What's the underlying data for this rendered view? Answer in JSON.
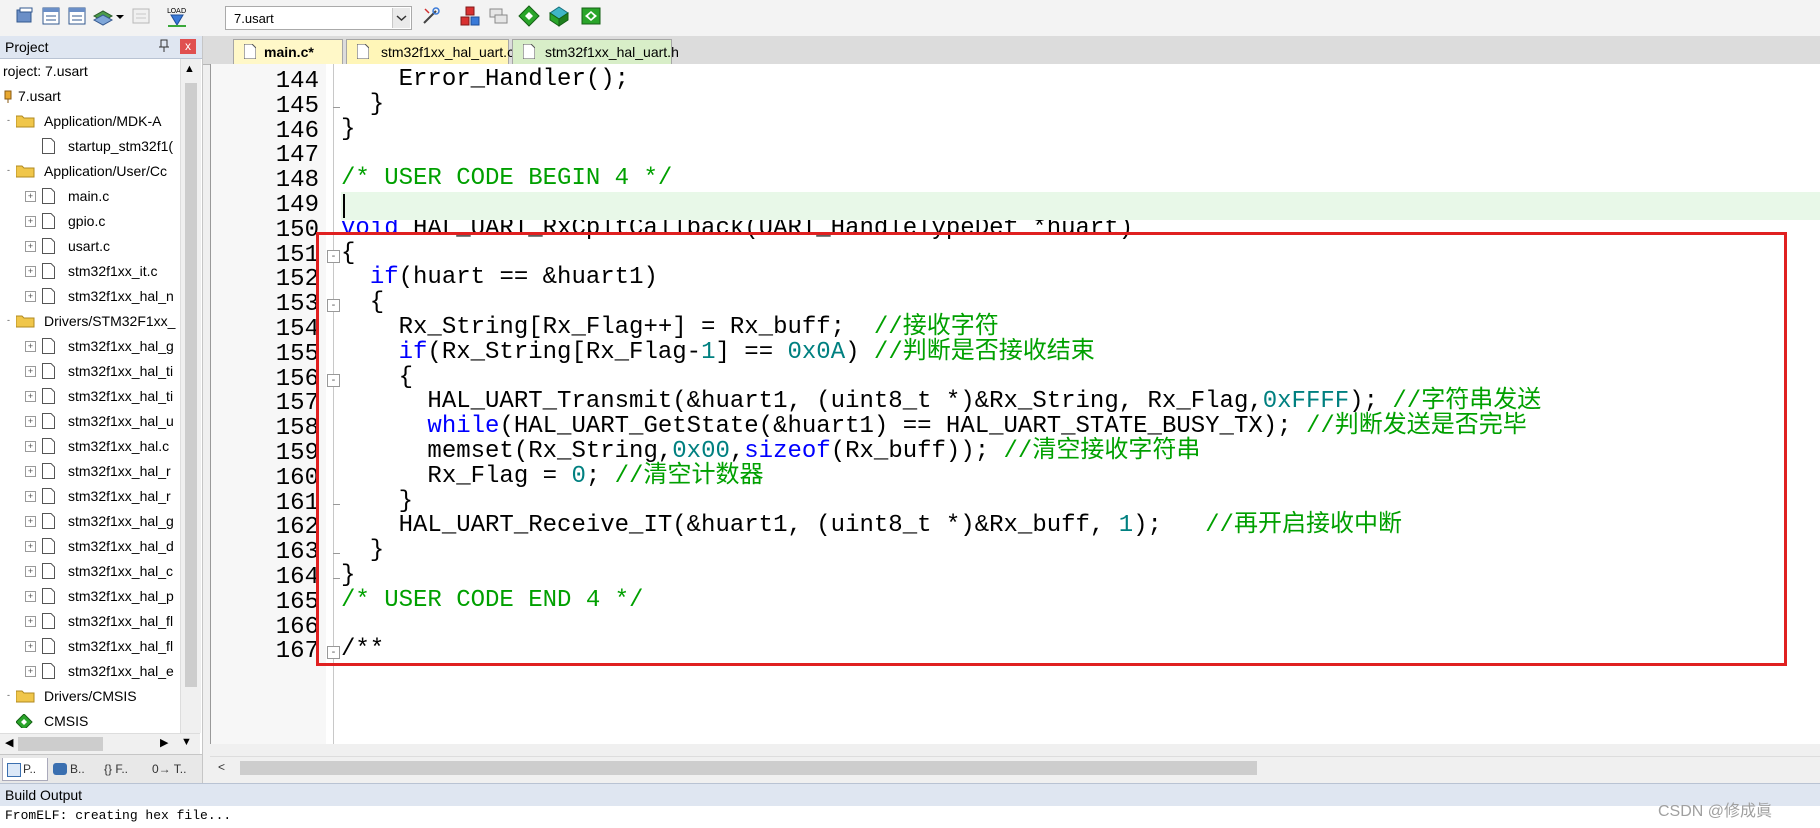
{
  "toolbar": {
    "target": "7.usart",
    "load_label": "LOAD",
    "icons": [
      "translate-icon",
      "build-icon",
      "rebuild-icon",
      "batch-build-icon",
      "stop-build-icon",
      "download-icon",
      "target-options-icon",
      "manage-components-icon",
      "pack-installer-icon",
      "select-packs-icon",
      "run-time-env-icon"
    ]
  },
  "project_panel": {
    "title": "Project",
    "pin": "ȣ",
    "close": "x",
    "tree": [
      {
        "label": "roject: 7.usart",
        "kind": "root"
      },
      {
        "label": "7.usart",
        "kind": "target"
      },
      {
        "label": "Application/MDK-A",
        "kind": "group"
      },
      {
        "label": "startup_stm32f1(",
        "kind": "file"
      },
      {
        "label": "Application/User/Cc",
        "kind": "group"
      },
      {
        "label": "main.c",
        "kind": "file"
      },
      {
        "label": "gpio.c",
        "kind": "file"
      },
      {
        "label": "usart.c",
        "kind": "file"
      },
      {
        "label": "stm32f1xx_it.c",
        "kind": "file"
      },
      {
        "label": "stm32f1xx_hal_n",
        "kind": "file"
      },
      {
        "label": "Drivers/STM32F1xx_",
        "kind": "group"
      },
      {
        "label": "stm32f1xx_hal_g",
        "kind": "file"
      },
      {
        "label": "stm32f1xx_hal_ti",
        "kind": "file"
      },
      {
        "label": "stm32f1xx_hal_ti",
        "kind": "file"
      },
      {
        "label": "stm32f1xx_hal_u",
        "kind": "file"
      },
      {
        "label": "stm32f1xx_hal.c",
        "kind": "file"
      },
      {
        "label": "stm32f1xx_hal_r",
        "kind": "file"
      },
      {
        "label": "stm32f1xx_hal_r",
        "kind": "file"
      },
      {
        "label": "stm32f1xx_hal_g",
        "kind": "file"
      },
      {
        "label": "stm32f1xx_hal_d",
        "kind": "file"
      },
      {
        "label": "stm32f1xx_hal_c",
        "kind": "file"
      },
      {
        "label": "stm32f1xx_hal_p",
        "kind": "file"
      },
      {
        "label": "stm32f1xx_hal_fl",
        "kind": "file"
      },
      {
        "label": "stm32f1xx_hal_fl",
        "kind": "file"
      },
      {
        "label": "stm32f1xx_hal_e",
        "kind": "file"
      },
      {
        "label": "Drivers/CMSIS",
        "kind": "group"
      },
      {
        "label": "CMSIS",
        "kind": "component"
      }
    ],
    "tabs": [
      "P..",
      "B..",
      "{} F..",
      "0→ T.."
    ]
  },
  "editor": {
    "tabs": [
      {
        "label": "main.c*",
        "active": true
      },
      {
        "label": "stm32f1xx_hal_uart.c",
        "active": false
      },
      {
        "label": "stm32f1xx_hal_uart.h",
        "active": false
      }
    ],
    "line_numbers": [
      "144",
      "145",
      "146",
      "147",
      "148",
      "149",
      "150",
      "151",
      "152",
      "153",
      "154",
      "155",
      "156",
      "157",
      "158",
      "159",
      "160",
      "161",
      "162",
      "163",
      "164",
      "165",
      "166",
      "167"
    ],
    "lines": [
      [
        [
          "",
          "    Error_Handler();"
        ]
      ],
      [
        [
          "",
          "  }"
        ]
      ],
      [
        [
          "",
          "}"
        ]
      ],
      [
        [
          "",
          ""
        ]
      ],
      [
        [
          "cm",
          "/* USER CODE BEGIN 4 */"
        ]
      ],
      [
        [
          "",
          ""
        ]
      ],
      [
        [
          "kw",
          "void"
        ],
        [
          "",
          " HAL_UART_RxCpltCallback(UART_HandleTypeDef *huart)"
        ]
      ],
      [
        [
          "",
          "{"
        ]
      ],
      [
        [
          "",
          "  "
        ],
        [
          "kw",
          "if"
        ],
        [
          "",
          "(huart == &huart1)"
        ]
      ],
      [
        [
          "",
          "  {"
        ]
      ],
      [
        [
          "",
          "    Rx_String[Rx_Flag++] = Rx_buff;  "
        ],
        [
          "cm",
          "//接收字符"
        ]
      ],
      [
        [
          "",
          "    "
        ],
        [
          "kw",
          "if"
        ],
        [
          "",
          "(Rx_String[Rx_Flag-"
        ],
        [
          "nm",
          "1"
        ],
        [
          "",
          "] == "
        ],
        [
          "nm",
          "0x0A"
        ],
        [
          "",
          ") "
        ],
        [
          "cm",
          "//判断是否接收结束"
        ]
      ],
      [
        [
          "",
          "    {"
        ]
      ],
      [
        [
          "",
          "      HAL_UART_Transmit(&huart1, (uint8_t *)&Rx_String, Rx_Flag,"
        ],
        [
          "nm",
          "0xFFFF"
        ],
        [
          "",
          "); "
        ],
        [
          "cm",
          "//字符串发送"
        ]
      ],
      [
        [
          "",
          "      "
        ],
        [
          "kw",
          "while"
        ],
        [
          "",
          "(HAL_UART_GetState(&huart1) == HAL_UART_STATE_BUSY_TX); "
        ],
        [
          "cm",
          "//判断发送是否完毕"
        ]
      ],
      [
        [
          "",
          "      memset(Rx_String,"
        ],
        [
          "nm",
          "0x00"
        ],
        [
          "",
          ","
        ],
        [
          "kw",
          "sizeof"
        ],
        [
          "",
          "(Rx_buff)); "
        ],
        [
          "cm",
          "//清空接收字符串"
        ]
      ],
      [
        [
          "",
          "      Rx_Flag = "
        ],
        [
          "nm",
          "0"
        ],
        [
          "",
          "; "
        ],
        [
          "cm",
          "//清空计数器"
        ]
      ],
      [
        [
          "",
          "    }"
        ]
      ],
      [
        [
          "",
          "    HAL_UART_Receive_IT(&huart1, (uint8_t *)&Rx_buff, "
        ],
        [
          "nm",
          "1"
        ],
        [
          "",
          ");   "
        ],
        [
          "cm",
          "//再开启接收中断"
        ]
      ],
      [
        [
          "",
          "  }"
        ]
      ],
      [
        [
          "",
          "}"
        ]
      ],
      [
        [
          "cm",
          "/* USER CODE END 4 */"
        ]
      ],
      [
        [
          "",
          ""
        ]
      ],
      [
        [
          "",
          "/**"
        ]
      ]
    ],
    "current_line": "149"
  },
  "build_output": {
    "title": "Build Output",
    "text": "FromELF: creating hex file..."
  },
  "watermark": "CSDN @修成眞",
  "colors": {
    "keyword": "#0000ff",
    "comment": "#00a000",
    "number": "#008080",
    "highlight_box": "#e02020"
  }
}
